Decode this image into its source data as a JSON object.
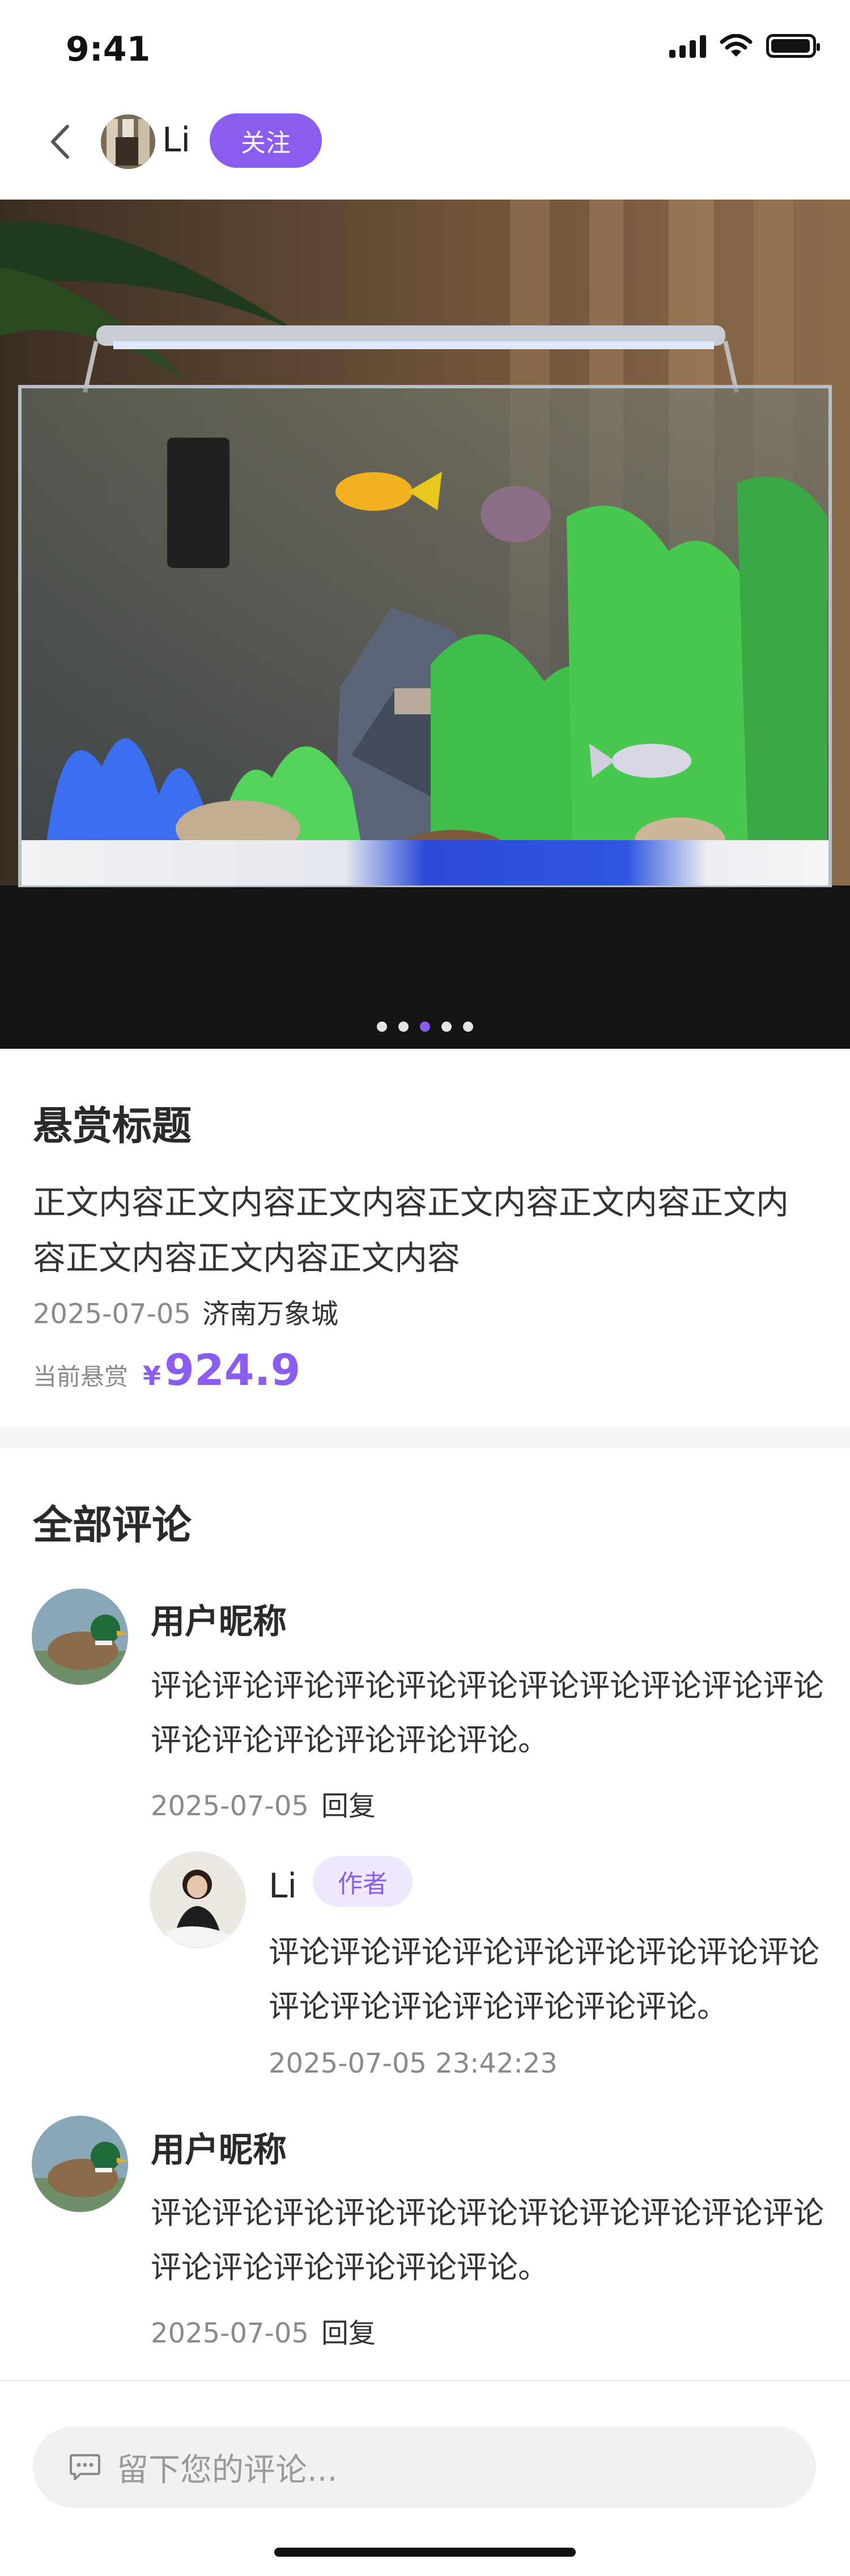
{
  "status_bar": {
    "time": "9:41"
  },
  "nav": {
    "author_name": "Li",
    "follow_label": "关注"
  },
  "carousel": {
    "total": 5,
    "active_index": 2
  },
  "post": {
    "title": "悬赏标题",
    "body": "正文内容正文内容正文内容正文内容正文内容正文内容正文内容正文内容正文内容",
    "date": "2025-07-05",
    "location": "济南万象城",
    "reward_label": "当前悬赏",
    "reward_currency": "¥",
    "reward_amount": "924.9"
  },
  "comments": {
    "title": "全部评论",
    "items": [
      {
        "name": "用户昵称",
        "text": "评论评论评论评论评论评论评论评论评论评论评论评论评论评论评论评论评论。",
        "date": "2025-07-05",
        "reply_label": "回复"
      },
      {
        "name": "用户昵称",
        "text": "评论评论评论评论评论评论评论评论评论评论评论评论评论评论评论评论评论。",
        "date": "2025-07-05",
        "reply_label": "回复"
      }
    ],
    "reply": {
      "name": "Li",
      "badge": "作者",
      "text": "评论评论评论评论评论评论评论评论评论评论评论评论评论评论评论评论。",
      "datetime": "2025-07-05 23:42:23"
    }
  },
  "input": {
    "placeholder": "留下您的评论..."
  },
  "colors": {
    "accent": "#8a5cf0",
    "badge_bg": "#efe8ff",
    "divider": "#f3f4f6"
  }
}
